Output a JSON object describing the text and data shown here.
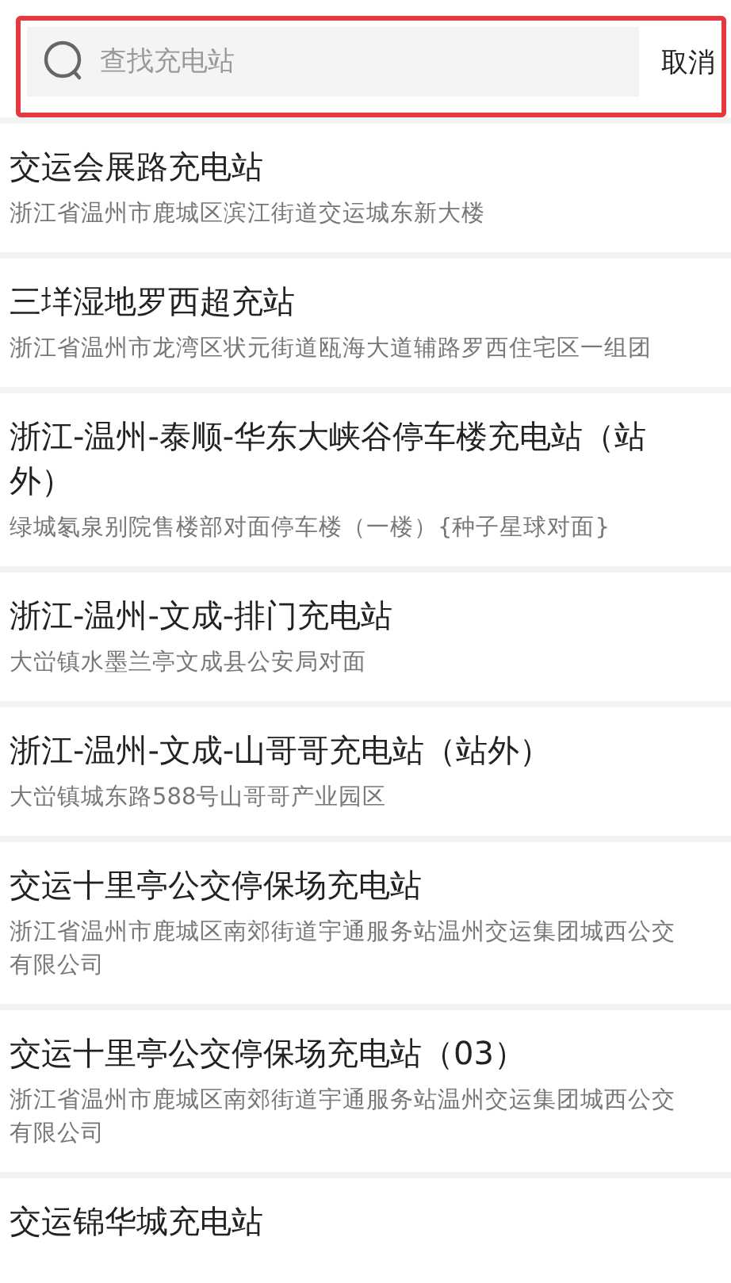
{
  "search": {
    "placeholder": "查找充电站",
    "highlighted": true,
    "cancel_label": "取消"
  },
  "stations": [
    {
      "name": "交运会展路充电站",
      "address": "浙江省温州市鹿城区滨江街道交运城东新大楼"
    },
    {
      "name": "三垟湿地罗西超充站",
      "address": "浙江省温州市龙湾区状元街道瓯海大道辅路罗西住宅区一组团"
    },
    {
      "name": "浙江-温州-泰顺-华东大峡谷停车楼充电站（站外）",
      "address": "绿城氡泉别院售楼部对面停车楼（一楼）{种子星球对面}"
    },
    {
      "name": "浙江-温州-文成-排门充电站",
      "address": "大峃镇水墨兰亭文成县公安局对面"
    },
    {
      "name": "浙江-温州-文成-山哥哥充电站（站外）",
      "address": "大峃镇城东路588号山哥哥产业园区"
    },
    {
      "name": "交运十里亭公交停保场充电站",
      "address": "浙江省温州市鹿城区南郊街道宇通服务站温州交运集团城西公交有限公司"
    },
    {
      "name": "交运十里亭公交停保场充电站（03）",
      "address": "浙江省温州市鹿城区南郊街道宇通服务站温州交运集团城西公交有限公司"
    },
    {
      "name": "交运锦华城充电站"
    }
  ]
}
